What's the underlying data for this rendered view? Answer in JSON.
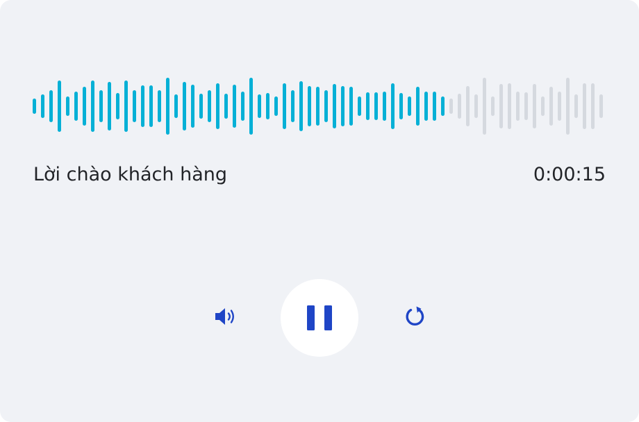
{
  "player": {
    "title": "Lời chào khách hàng",
    "time": "0:00:15",
    "playback_state": "playing",
    "progress": 0.72,
    "colors": {
      "card_background": "#f0f2f6",
      "played": "#06b0d6",
      "unplayed": "#d5d9df",
      "control": "#1f45c6",
      "play_button_background": "#ffffff"
    },
    "controls": {
      "volume_icon": "volume-icon",
      "play_pause_icon": "pause-icon",
      "replay_icon": "replay-icon"
    },
    "waveform_levels": [
      0.23,
      0.38,
      0.5,
      0.8,
      0.31,
      0.45,
      0.61,
      0.8,
      0.5,
      0.76,
      0.42,
      0.8,
      0.49,
      0.65,
      0.65,
      0.5,
      0.9,
      0.38,
      0.76,
      0.67,
      0.4,
      0.5,
      0.71,
      0.4,
      0.67,
      0.45,
      0.9,
      0.37,
      0.42,
      0.3,
      0.72,
      0.5,
      0.78,
      0.62,
      0.61,
      0.5,
      0.69,
      0.63,
      0.6,
      0.3,
      0.44,
      0.44,
      0.45,
      0.72,
      0.42,
      0.31,
      0.6,
      0.45,
      0.45,
      0.3,
      0.23,
      0.4,
      0.62,
      0.38,
      0.9,
      0.3,
      0.7,
      0.71,
      0.45,
      0.43,
      0.7,
      0.3,
      0.61,
      0.45,
      0.9,
      0.38,
      0.72,
      0.71,
      0.38
    ]
  }
}
